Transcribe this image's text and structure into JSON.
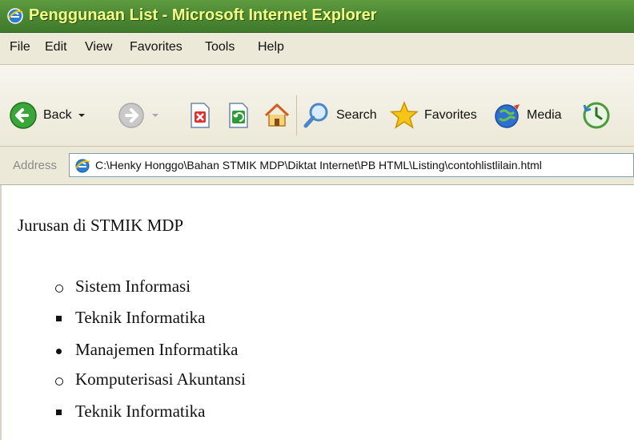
{
  "window": {
    "title": "Penggunaan List - Microsoft Internet Explorer",
    "title_color": "#f3ff86",
    "titlebar_color": "#4d8a36"
  },
  "menu": {
    "items": [
      "File",
      "Edit",
      "View",
      "Favorites",
      "Tools",
      "Help"
    ]
  },
  "toolbar": {
    "back_label": "Back",
    "search_label": "Search",
    "favorites_label": "Favorites",
    "media_label": "Media",
    "icons": [
      "back-icon",
      "forward-icon",
      "stop-icon",
      "refresh-icon",
      "home-icon",
      "search-icon",
      "favorites-star-icon",
      "media-icon",
      "history-icon"
    ]
  },
  "address": {
    "label": "Address",
    "value": "C:\\Henky Honggo\\Bahan STMIK MDP\\Diktat Internet\\PB HTML\\Listing\\contohlistlilain.html"
  },
  "content": {
    "heading": "Jurusan di STMIK MDP",
    "items": [
      {
        "text": "Sistem Informasi",
        "bullet": "circle"
      },
      {
        "text": "Teknik Informatika",
        "bullet": "square"
      },
      {
        "text": "Manajemen Informatika",
        "bullet": "disc"
      },
      {
        "text": "Komputerisasi Akuntansi",
        "bullet": "circle"
      },
      {
        "text": "Teknik Informatika",
        "bullet": "square"
      }
    ]
  }
}
